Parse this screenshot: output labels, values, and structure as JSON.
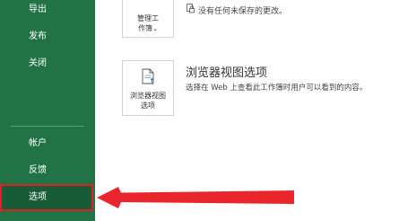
{
  "sidebar": {
    "items_top": [
      {
        "label": "导出"
      },
      {
        "label": "发布"
      },
      {
        "label": "关闭"
      }
    ],
    "items_bottom": [
      {
        "label": "帐户"
      },
      {
        "label": "反馈"
      },
      {
        "label": "选项"
      }
    ],
    "selected": "选项"
  },
  "main": {
    "manage_tile": {
      "label_line1": "管理工",
      "label_line2": "作簿",
      "chevron": "⌄"
    },
    "unsaved_text": "没有任何未保存的更改。",
    "browser_tile": {
      "label_line1": "浏览器视图",
      "label_line2": "选项"
    },
    "browser_heading": "浏览器视图选项",
    "browser_desc": "选择在 Web 上查看此工作簿时用户可以看到的内容。"
  },
  "colors": {
    "sidebar_bg": "#217346",
    "selected_bg": "#185c37",
    "highlight_red": "#d6242a"
  },
  "icons": [
    "document-lock-icon",
    "document-upload-icon",
    "red-arrow-annotation"
  ]
}
